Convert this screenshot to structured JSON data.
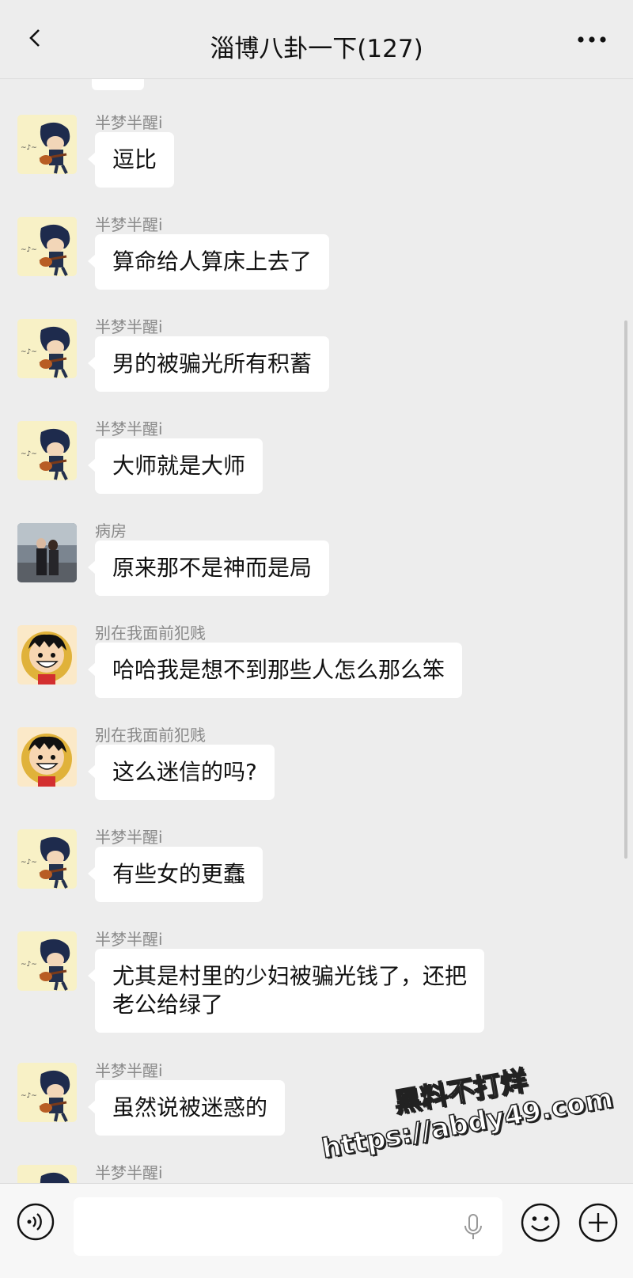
{
  "header": {
    "title": "淄博八卦一下(127)"
  },
  "messages": [
    {
      "sender": "半梦半醒i",
      "avatar": "guitar-boy",
      "text": "逗比"
    },
    {
      "sender": "半梦半醒i",
      "avatar": "guitar-boy",
      "text": "算命给人算床上去了"
    },
    {
      "sender": "半梦半醒i",
      "avatar": "guitar-boy",
      "text": "男的被骗光所有积蓄"
    },
    {
      "sender": "半梦半醒i",
      "avatar": "guitar-boy",
      "text": "大师就是大师"
    },
    {
      "sender": "病房",
      "avatar": "couple-photo",
      "text": "原来那不是神而是局"
    },
    {
      "sender": "别在我面前犯贱",
      "avatar": "luffy",
      "text": "哈哈我是想不到那些人怎么那么笨"
    },
    {
      "sender": "别在我面前犯贱",
      "avatar": "luffy",
      "text": "这么迷信的吗?"
    },
    {
      "sender": "半梦半醒i",
      "avatar": "guitar-boy",
      "text": "有些女的更蠢"
    },
    {
      "sender": "半梦半醒i",
      "avatar": "guitar-boy",
      "text_lines": [
        "尤其是村里的少妇被骗光钱了，还把",
        "老公给绿了"
      ]
    },
    {
      "sender": "半梦半醒i",
      "avatar": "guitar-boy",
      "text": "虽然说被迷惑的"
    },
    {
      "sender": "半梦半醒i",
      "avatar": "guitar-boy",
      "text": ""
    }
  ],
  "watermark": {
    "line1": "黑料不打烊",
    "line2": "https://abdy49.com"
  },
  "icons": {
    "back": "chevron-left-icon",
    "more": "more-dots-icon",
    "voice": "voice-icon",
    "mic": "microphone-icon",
    "emoji": "emoji-icon",
    "plus": "plus-icon"
  },
  "colors": {
    "background": "#ededed",
    "bubble": "#ffffff",
    "name": "#8a8a8a"
  }
}
